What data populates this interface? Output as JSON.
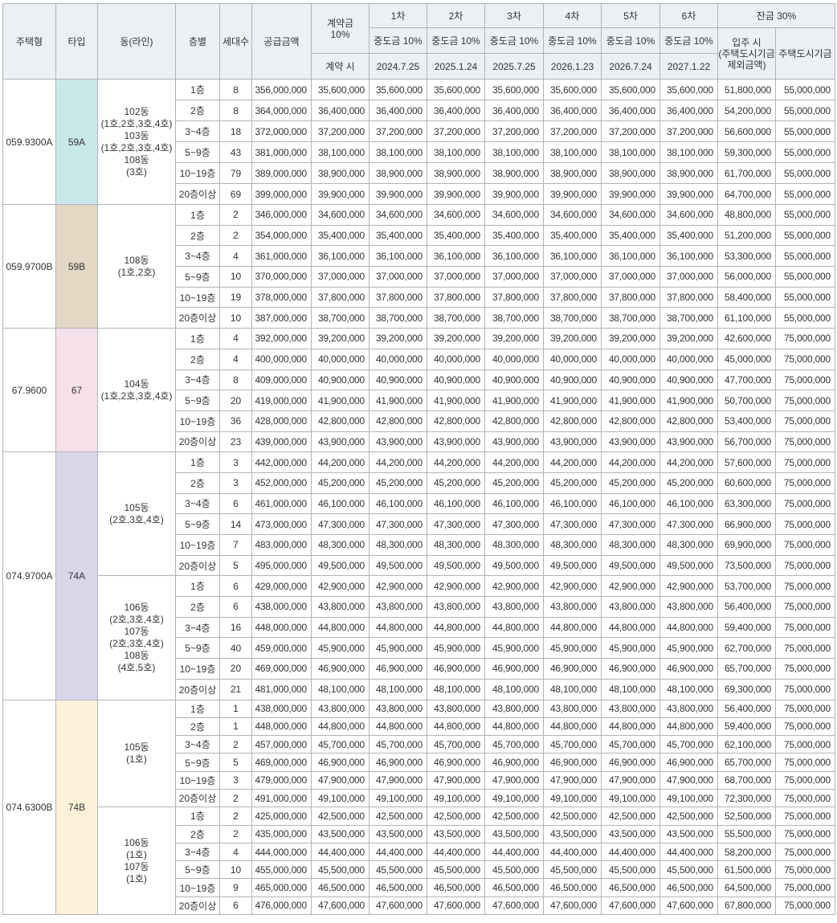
{
  "header": {
    "housing_type": "주택형",
    "type": "타입",
    "dong_line": "동(라인)",
    "floor": "층별",
    "units": "세대수",
    "supply_amount": "공급금액",
    "contract_title": "계약금",
    "contract_pct": "10%",
    "contract_sub": "계약 시",
    "round_labels": [
      "1차",
      "2차",
      "3차",
      "4차",
      "5차",
      "6차"
    ],
    "mid_payment": "중도금 10%",
    "dates": [
      "2024.7.25",
      "2025.1.24",
      "2025.7.25",
      "2026.1.23",
      "2026.7.24",
      "2027.1.22"
    ],
    "balance": "잔금 30%",
    "movein_line1": "입주 시",
    "movein_line2": "(주택도시기금",
    "movein_line3": "제외금액)",
    "fund": "주택도시기금"
  },
  "colors": {
    "59A": "#c9e8ea",
    "59B": "#e2d8c4",
    "67": "#f6e0ea",
    "74A": "#d9d6ea",
    "74B": "#fdf2d9",
    "header_bg": "#eceff3",
    "border": "#aeb4bd"
  },
  "groups": [
    {
      "housing_type": "059.9300A",
      "type": "59A",
      "color_key": "59A",
      "subgroups": [
        {
          "dong_lines": [
            "102동",
            "(1호,2호,3호,4호)",
            "103동",
            "(1호,2호,3호,4호)",
            "108동",
            "(3호)"
          ],
          "rows": [
            {
              "floor": "1층",
              "units": "8",
              "supply": "356,000,000",
              "contract": "35,600,000",
              "mid": "35,600,000",
              "movein": "51,800,000",
              "fund": "55,000,000"
            },
            {
              "floor": "2층",
              "units": "8",
              "supply": "364,000,000",
              "contract": "36,400,000",
              "mid": "36,400,000",
              "movein": "54,200,000",
              "fund": "55,000,000"
            },
            {
              "floor": "3~4층",
              "units": "18",
              "supply": "372,000,000",
              "contract": "37,200,000",
              "mid": "37,200,000",
              "movein": "56,600,000",
              "fund": "55,000,000"
            },
            {
              "floor": "5~9층",
              "units": "43",
              "supply": "381,000,000",
              "contract": "38,100,000",
              "mid": "38,100,000",
              "movein": "59,300,000",
              "fund": "55,000,000"
            },
            {
              "floor": "10~19층",
              "units": "79",
              "supply": "389,000,000",
              "contract": "38,900,000",
              "mid": "38,900,000",
              "movein": "61,700,000",
              "fund": "55,000,000"
            },
            {
              "floor": "20층이상",
              "units": "69",
              "supply": "399,000,000",
              "contract": "39,900,000",
              "mid": "39,900,000",
              "movein": "64,700,000",
              "fund": "55,000,000"
            }
          ]
        }
      ]
    },
    {
      "housing_type": "059.9700B",
      "type": "59B",
      "color_key": "59B",
      "subgroups": [
        {
          "dong_lines": [
            "108동",
            "(1호,2호)"
          ],
          "rows": [
            {
              "floor": "1층",
              "units": "2",
              "supply": "346,000,000",
              "contract": "34,600,000",
              "mid": "34,600,000",
              "movein": "48,800,000",
              "fund": "55,000,000"
            },
            {
              "floor": "2층",
              "units": "2",
              "supply": "354,000,000",
              "contract": "35,400,000",
              "mid": "35,400,000",
              "movein": "51,200,000",
              "fund": "55,000,000"
            },
            {
              "floor": "3~4층",
              "units": "4",
              "supply": "361,000,000",
              "contract": "36,100,000",
              "mid": "36,100,000",
              "movein": "53,300,000",
              "fund": "55,000,000"
            },
            {
              "floor": "5~9층",
              "units": "10",
              "supply": "370,000,000",
              "contract": "37,000,000",
              "mid": "37,000,000",
              "movein": "56,000,000",
              "fund": "55,000,000"
            },
            {
              "floor": "10~19층",
              "units": "19",
              "supply": "378,000,000",
              "contract": "37,800,000",
              "mid": "37,800,000",
              "movein": "58,400,000",
              "fund": "55,000,000"
            },
            {
              "floor": "20층이상",
              "units": "10",
              "supply": "387,000,000",
              "contract": "38,700,000",
              "mid": "38,700,000",
              "movein": "61,100,000",
              "fund": "55,000,000"
            }
          ]
        }
      ]
    },
    {
      "housing_type": "67.9600",
      "type": "67",
      "color_key": "67",
      "subgroups": [
        {
          "dong_lines": [
            "104동",
            "(1호,2호,3호,4호)"
          ],
          "rows": [
            {
              "floor": "1층",
              "units": "4",
              "supply": "392,000,000",
              "contract": "39,200,000",
              "mid": "39,200,000",
              "movein": "42,600,000",
              "fund": "75,000,000"
            },
            {
              "floor": "2층",
              "units": "4",
              "supply": "400,000,000",
              "contract": "40,000,000",
              "mid": "40,000,000",
              "movein": "45,000,000",
              "fund": "75,000,000"
            },
            {
              "floor": "3~4층",
              "units": "8",
              "supply": "409,000,000",
              "contract": "40,900,000",
              "mid": "40,900,000",
              "movein": "47,700,000",
              "fund": "75,000,000"
            },
            {
              "floor": "5~9층",
              "units": "20",
              "supply": "419,000,000",
              "contract": "41,900,000",
              "mid": "41,900,000",
              "movein": "50,700,000",
              "fund": "75,000,000"
            },
            {
              "floor": "10~19층",
              "units": "36",
              "supply": "428,000,000",
              "contract": "42,800,000",
              "mid": "42,800,000",
              "movein": "53,400,000",
              "fund": "75,000,000"
            },
            {
              "floor": "20층이상",
              "units": "23",
              "supply": "439,000,000",
              "contract": "43,900,000",
              "mid": "43,900,000",
              "movein": "56,700,000",
              "fund": "75,000,000"
            }
          ]
        }
      ]
    },
    {
      "housing_type": "074.9700A",
      "type": "74A",
      "color_key": "74A",
      "subgroups": [
        {
          "dong_lines": [
            "105동",
            "(2호,3호,4호)"
          ],
          "rows": [
            {
              "floor": "1층",
              "units": "3",
              "supply": "442,000,000",
              "contract": "44,200,000",
              "mid": "44,200,000",
              "movein": "57,600,000",
              "fund": "75,000,000"
            },
            {
              "floor": "2층",
              "units": "3",
              "supply": "452,000,000",
              "contract": "45,200,000",
              "mid": "45,200,000",
              "movein": "60,600,000",
              "fund": "75,000,000"
            },
            {
              "floor": "3~4층",
              "units": "6",
              "supply": "461,000,000",
              "contract": "46,100,000",
              "mid": "46,100,000",
              "movein": "63,300,000",
              "fund": "75,000,000"
            },
            {
              "floor": "5~9층",
              "units": "14",
              "supply": "473,000,000",
              "contract": "47,300,000",
              "mid": "47,300,000",
              "movein": "66,900,000",
              "fund": "75,000,000"
            },
            {
              "floor": "10~19층",
              "units": "7",
              "supply": "483,000,000",
              "contract": "48,300,000",
              "mid": "48,300,000",
              "movein": "69,900,000",
              "fund": "75,000,000"
            },
            {
              "floor": "20층이상",
              "units": "5",
              "supply": "495,000,000",
              "contract": "49,500,000",
              "mid": "49,500,000",
              "movein": "73,500,000",
              "fund": "75,000,000"
            }
          ]
        },
        {
          "dong_lines": [
            "106동",
            "(2호,3호,4호)",
            "107동",
            "(2호,3호,4호)",
            "108동",
            "(4호,5호)"
          ],
          "rows": [
            {
              "floor": "1층",
              "units": "6",
              "supply": "429,000,000",
              "contract": "42,900,000",
              "mid": "42,900,000",
              "movein": "53,700,000",
              "fund": "75,000,000"
            },
            {
              "floor": "2층",
              "units": "6",
              "supply": "438,000,000",
              "contract": "43,800,000",
              "mid": "43,800,000",
              "movein": "56,400,000",
              "fund": "75,000,000"
            },
            {
              "floor": "3~4층",
              "units": "16",
              "supply": "448,000,000",
              "contract": "44,800,000",
              "mid": "44,800,000",
              "movein": "59,400,000",
              "fund": "75,000,000"
            },
            {
              "floor": "5~9층",
              "units": "40",
              "supply": "459,000,000",
              "contract": "45,900,000",
              "mid": "45,900,000",
              "movein": "62,700,000",
              "fund": "75,000,000"
            },
            {
              "floor": "10~19층",
              "units": "20",
              "supply": "469,000,000",
              "contract": "46,900,000",
              "mid": "46,900,000",
              "movein": "65,700,000",
              "fund": "75,000,000"
            },
            {
              "floor": "20층이상",
              "units": "21",
              "supply": "481,000,000",
              "contract": "48,100,000",
              "mid": "48,100,000",
              "movein": "69,300,000",
              "fund": "75,000,000"
            }
          ]
        }
      ]
    },
    {
      "housing_type": "074.6300B",
      "type": "74B",
      "color_key": "74B",
      "subgroups": [
        {
          "dong_lines": [
            "105동",
            "(1호)"
          ],
          "rows": [
            {
              "floor": "1층",
              "units": "1",
              "supply": "438,000,000",
              "contract": "43,800,000",
              "mid": "43,800,000",
              "movein": "56,400,000",
              "fund": "75,000,000"
            },
            {
              "floor": "2층",
              "units": "1",
              "supply": "448,000,000",
              "contract": "44,800,000",
              "mid": "44,800,000",
              "movein": "59,400,000",
              "fund": "75,000,000"
            },
            {
              "floor": "3~4층",
              "units": "2",
              "supply": "457,000,000",
              "contract": "45,700,000",
              "mid": "45,700,000",
              "movein": "62,100,000",
              "fund": "75,000,000"
            },
            {
              "floor": "5~9층",
              "units": "5",
              "supply": "469,000,000",
              "contract": "46,900,000",
              "mid": "46,900,000",
              "movein": "65,700,000",
              "fund": "75,000,000"
            },
            {
              "floor": "10~19층",
              "units": "3",
              "supply": "479,000,000",
              "contract": "47,900,000",
              "mid": "47,900,000",
              "movein": "68,700,000",
              "fund": "75,000,000"
            },
            {
              "floor": "20층이상",
              "units": "2",
              "supply": "491,000,000",
              "contract": "49,100,000",
              "mid": "49,100,000",
              "movein": "72,300,000",
              "fund": "75,000,000"
            }
          ]
        },
        {
          "dong_lines": [
            "106동",
            "(1호)",
            "107동",
            "(1호)"
          ],
          "rows": [
            {
              "floor": "1층",
              "units": "2",
              "supply": "425,000,000",
              "contract": "42,500,000",
              "mid": "42,500,000",
              "movein": "52,500,000",
              "fund": "75,000,000"
            },
            {
              "floor": "2층",
              "units": "2",
              "supply": "435,000,000",
              "contract": "43,500,000",
              "mid": "43,500,000",
              "movein": "55,500,000",
              "fund": "75,000,000"
            },
            {
              "floor": "3~4층",
              "units": "4",
              "supply": "444,000,000",
              "contract": "44,400,000",
              "mid": "44,400,000",
              "movein": "58,200,000",
              "fund": "75,000,000"
            },
            {
              "floor": "5~9층",
              "units": "10",
              "supply": "455,000,000",
              "contract": "45,500,000",
              "mid": "45,500,000",
              "movein": "61,500,000",
              "fund": "75,000,000"
            },
            {
              "floor": "10~19층",
              "units": "9",
              "supply": "465,000,000",
              "contract": "46,500,000",
              "mid": "46,500,000",
              "movein": "64,500,000",
              "fund": "75,000,000"
            },
            {
              "floor": "20층이상",
              "units": "6",
              "supply": "476,000,000",
              "contract": "47,600,000",
              "mid": "47,600,000",
              "movein": "67,800,000",
              "fund": "75,000,000"
            }
          ]
        }
      ]
    }
  ]
}
